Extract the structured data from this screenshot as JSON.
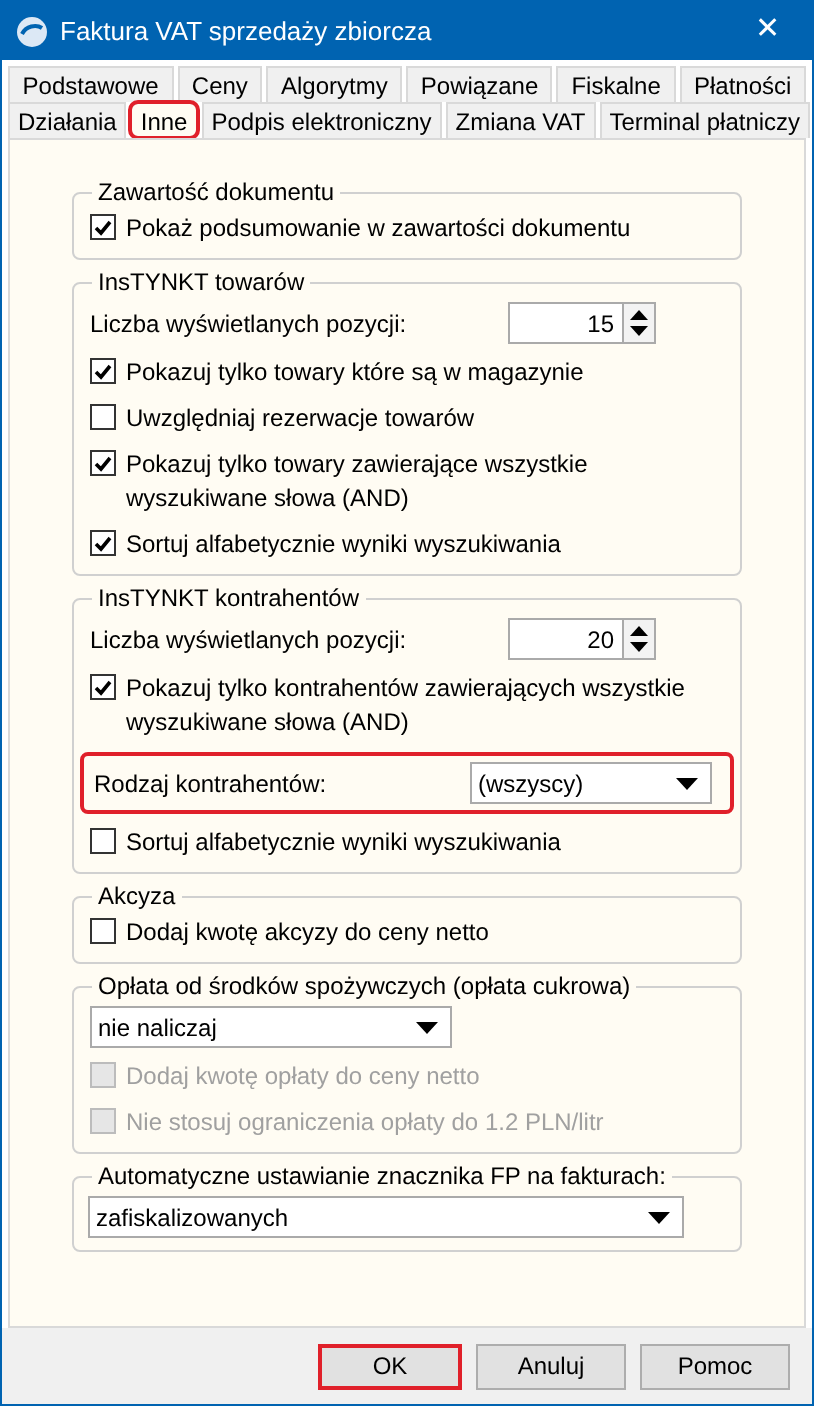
{
  "window": {
    "title": "Faktura VAT sprzedaży zbiorcza",
    "close": "✕"
  },
  "tab_rows": [
    {
      "tabs": [
        {
          "label": "Podstawowe",
          "selected": false,
          "highlighted": false
        },
        {
          "label": "Ceny",
          "selected": false,
          "highlighted": false
        },
        {
          "label": "Algorytmy",
          "selected": false,
          "highlighted": false
        },
        {
          "label": "Powiązane",
          "selected": false,
          "highlighted": false
        },
        {
          "label": "Fiskalne",
          "selected": false,
          "highlighted": false
        },
        {
          "label": "Płatności",
          "selected": false,
          "highlighted": false
        }
      ]
    },
    {
      "tabs": [
        {
          "label": "Działania",
          "selected": false,
          "highlighted": false
        },
        {
          "label": "Inne",
          "selected": true,
          "highlighted": true
        },
        {
          "label": "Podpis elektroniczny",
          "selected": false,
          "highlighted": false
        },
        {
          "label": "Zmiana VAT",
          "selected": false,
          "highlighted": false
        },
        {
          "label": "Terminal płatniczy",
          "selected": false,
          "highlighted": false
        }
      ]
    }
  ],
  "sections": [
    {
      "title": "Zawartość dokumentu",
      "items": [
        {
          "kind": "checkbox",
          "label": "Pokaż podsumowanie w zawartości dokumentu",
          "checked": true,
          "disabled": false
        }
      ]
    },
    {
      "title": "InsTYNKT towarów",
      "items": [
        {
          "kind": "spinner",
          "label": "Liczba wyświetlanych pozycji:",
          "value": "15"
        },
        {
          "kind": "checkbox",
          "label": "Pokazuj tylko towary które są w magazynie",
          "checked": true,
          "disabled": false
        },
        {
          "kind": "checkbox",
          "label": "Uwzględniaj rezerwacje towarów",
          "checked": false,
          "disabled": false
        },
        {
          "kind": "checkbox",
          "label": "Pokazuj tylko towary zawierające wszystkie wyszukiwane słowa (AND)",
          "checked": true,
          "disabled": false
        },
        {
          "kind": "checkbox",
          "label": "Sortuj alfabetycznie wyniki wyszukiwania",
          "checked": true,
          "disabled": false
        }
      ]
    },
    {
      "title": "InsTYNKT kontrahentów",
      "items": [
        {
          "kind": "spinner",
          "label": "Liczba wyświetlanych pozycji:",
          "value": "20"
        },
        {
          "kind": "checkbox",
          "label": "Pokazuj tylko kontrahentów zawierających wszystkie wyszukiwane słowa (AND)",
          "checked": true,
          "disabled": false
        },
        {
          "kind": "labeled_dropdown",
          "label": "Rodzaj kontrahentów:",
          "value": "(wszyscy)",
          "highlighted": true
        },
        {
          "kind": "checkbox",
          "label": "Sortuj alfabetycznie wyniki wyszukiwania",
          "checked": false,
          "disabled": false
        }
      ]
    },
    {
      "title": "Akcyza",
      "items": [
        {
          "kind": "checkbox",
          "label": "Dodaj kwotę akcyzy do ceny netto",
          "checked": false,
          "disabled": false
        }
      ]
    },
    {
      "title": "Opłata od środków spożywczych (opłata cukrowa)",
      "items": [
        {
          "kind": "short_dropdown",
          "value": "nie naliczaj"
        },
        {
          "kind": "checkbox",
          "label": "Dodaj kwotę opłaty do ceny netto",
          "checked": false,
          "disabled": true
        },
        {
          "kind": "checkbox",
          "label": "Nie stosuj ograniczenia opłaty do 1.2 PLN/litr",
          "checked": false,
          "disabled": true
        }
      ]
    },
    {
      "title": "Automatyczne ustawianie znacznika FP na fakturach:",
      "items": [
        {
          "kind": "wide_dropdown",
          "value": "zafiskalizowanych"
        }
      ]
    }
  ],
  "buttons": [
    {
      "label": "OK",
      "highlighted": true
    },
    {
      "label": "Anuluj",
      "highlighted": false
    },
    {
      "label": "Pomoc",
      "highlighted": false
    }
  ]
}
